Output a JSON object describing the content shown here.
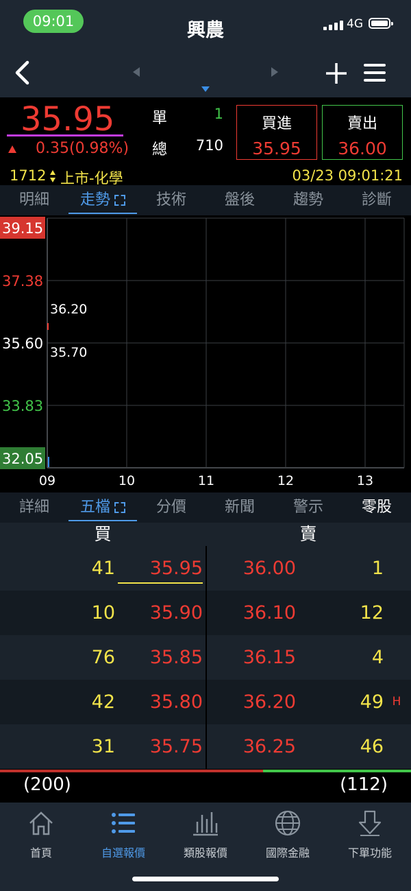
{
  "status": {
    "time": "09:01",
    "network": "4G"
  },
  "nav": {
    "title": "興農"
  },
  "quote": {
    "price": "35.95",
    "change": "0.35(0.98%)",
    "single_label": "單",
    "single_value": "1",
    "total_label": "總",
    "total_value": "710",
    "buy_label": "買進",
    "buy_price": "35.95",
    "sell_label": "賣出",
    "sell_price": "36.00",
    "code": "1712",
    "market": "上市-化學",
    "datetime": "03/23 09:01:21"
  },
  "top_tabs": [
    "明細",
    "走勢",
    "技術",
    "盤後",
    "趨勢",
    "診斷"
  ],
  "chart_data": {
    "type": "line",
    "y_ticks": [
      "39.15",
      "37.38",
      "35.60",
      "33.83",
      "32.05"
    ],
    "ylim": [
      32.05,
      39.15
    ],
    "x_ticks": [
      "09",
      "10",
      "11",
      "12",
      "13"
    ],
    "annotations": [
      "36.20",
      "35.70"
    ],
    "grid": true
  },
  "bottom_tabs": [
    "詳細",
    "五檔",
    "分價",
    "新聞",
    "警示",
    "零股"
  ],
  "order_book": {
    "buy_header": "買",
    "sell_header": "賣",
    "rows": [
      {
        "bid_qty": "41",
        "bid": "35.95",
        "ask": "36.00",
        "ask_qty": "1",
        "flag": ""
      },
      {
        "bid_qty": "10",
        "bid": "35.90",
        "ask": "36.10",
        "ask_qty": "12",
        "flag": ""
      },
      {
        "bid_qty": "76",
        "bid": "35.85",
        "ask": "36.15",
        "ask_qty": "4",
        "flag": ""
      },
      {
        "bid_qty": "42",
        "bid": "35.80",
        "ask": "36.20",
        "ask_qty": "49",
        "flag": "H"
      },
      {
        "bid_qty": "31",
        "bid": "35.75",
        "ask": "36.25",
        "ask_qty": "46",
        "flag": ""
      }
    ],
    "bid_total": "(200)",
    "ask_total": "(112)",
    "bid_ratio": 0.64
  },
  "bottom_nav": [
    {
      "label": "首頁",
      "icon": "home-icon"
    },
    {
      "label": "自選報價",
      "icon": "list-icon"
    },
    {
      "label": "類股報價",
      "icon": "bar-chart-icon"
    },
    {
      "label": "國際金融",
      "icon": "globe-icon"
    },
    {
      "label": "下單功能",
      "icon": "download-arrow-icon"
    }
  ],
  "colors": {
    "up": "#ee3b33",
    "down": "#42c54a",
    "accent": "#4f9ae8",
    "qty": "#f2e34a"
  }
}
